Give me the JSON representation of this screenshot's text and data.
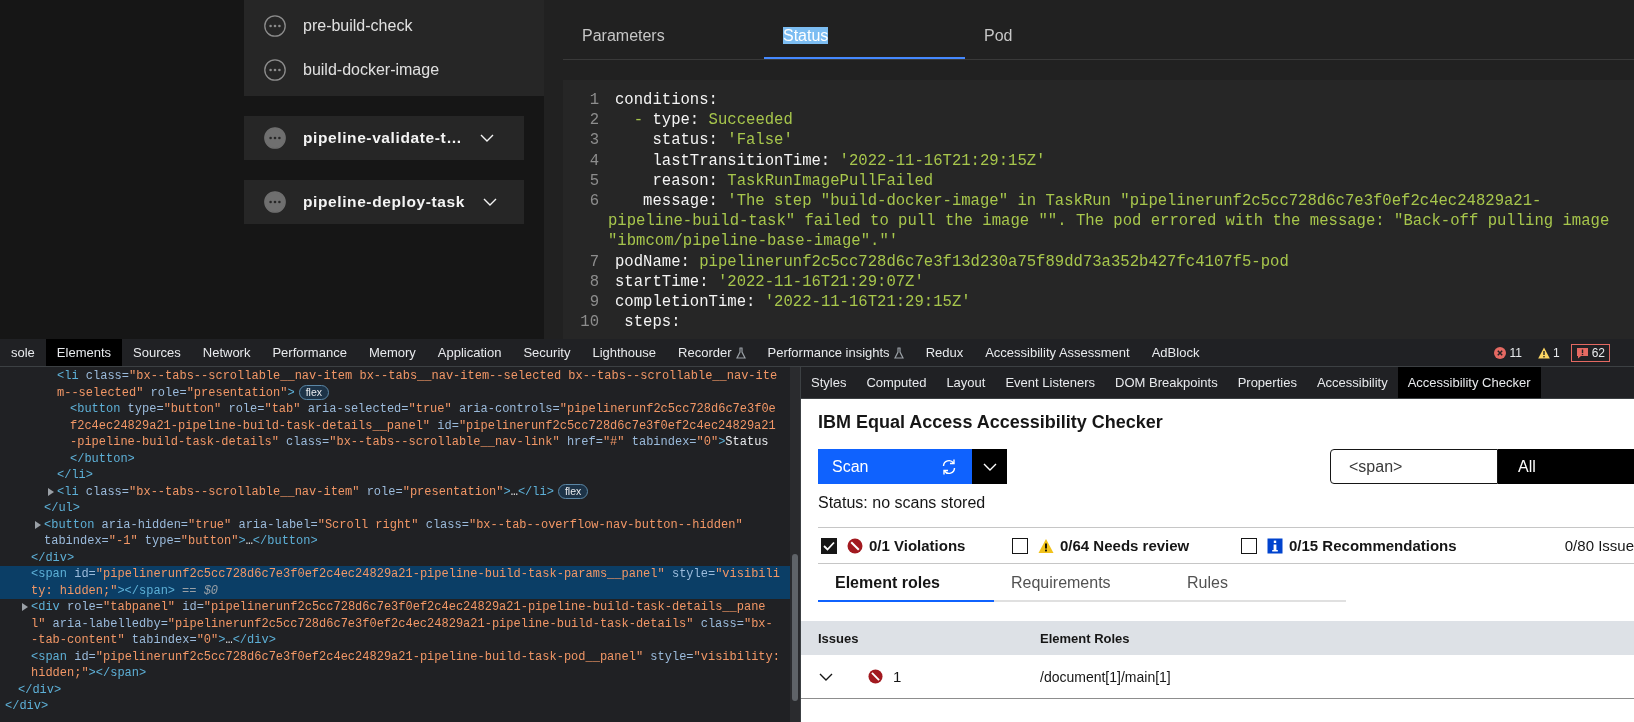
{
  "app": {
    "sidebar": {
      "steps": [
        {
          "label": "pre-build-check"
        },
        {
          "label": "build-docker-image"
        }
      ],
      "tasks": [
        {
          "label": "pipeline-validate-t…",
          "expanded": false
        },
        {
          "label": "pipeline-deploy-task",
          "expanded": false
        }
      ]
    },
    "tabs": [
      {
        "label": "Parameters",
        "selected": false,
        "highlighted": false
      },
      {
        "label": "Status",
        "selected": true,
        "highlighted": true
      },
      {
        "label": "Pod",
        "selected": false,
        "highlighted": false
      }
    ],
    "code_lines": [
      {
        "number": "1",
        "key": "conditions:"
      },
      {
        "number": "2",
        "bullet": "  -",
        "key": " type:",
        "value": "Succeeded"
      },
      {
        "number": "3",
        "key": "    status:",
        "value": "'False'"
      },
      {
        "number": "4",
        "key": "    lastTransitionTime:",
        "value": "'2022-11-16T21:29:15Z'"
      },
      {
        "number": "5",
        "key": "    reason:",
        "value": "TaskRunImagePullFailed"
      },
      {
        "number": "6",
        "key": "   message:",
        "value": "'The step \"build-docker-image\" in TaskRun \"pipelinerunf2c5cc728d6c7e3f0ef2c4ec24829a21-",
        "continued": [
          "pipeline-build-task\" failed to pull the image \"\". The pod errored with the message: \"Back-off pulling image",
          "\"ibmcom/pipeline-base-image\".\"'"
        ]
      },
      {
        "number": "7",
        "key": "podName:",
        "value": "pipelinerunf2c5cc728d6c7e3f13d230a75f89dd73a352b427fc4107f5-pod"
      },
      {
        "number": "8",
        "key": "startTime:",
        "value": "'2022-11-16T21:29:07Z'"
      },
      {
        "number": "9",
        "key": "completionTime:",
        "value": "'2022-11-16T21:29:15Z'"
      },
      {
        "number": "10",
        "key": " steps:"
      }
    ]
  },
  "devtools": {
    "tabs": [
      {
        "label": "sole",
        "selected": false,
        "experimental": false
      },
      {
        "label": "Elements",
        "selected": true,
        "experimental": false
      },
      {
        "label": "Sources",
        "selected": false,
        "experimental": false
      },
      {
        "label": "Network",
        "selected": false,
        "experimental": false
      },
      {
        "label": "Performance",
        "selected": false,
        "experimental": false
      },
      {
        "label": "Memory",
        "selected": false,
        "experimental": false
      },
      {
        "label": "Application",
        "selected": false,
        "experimental": false
      },
      {
        "label": "Security",
        "selected": false,
        "experimental": false
      },
      {
        "label": "Lighthouse",
        "selected": false,
        "experimental": false
      },
      {
        "label": "Recorder",
        "selected": false,
        "experimental": true
      },
      {
        "label": "Performance insights",
        "selected": false,
        "experimental": true
      },
      {
        "label": "Redux",
        "selected": false,
        "experimental": false
      },
      {
        "label": "Accessibility Assessment",
        "selected": false,
        "experimental": false
      },
      {
        "label": "AdBlock",
        "selected": false,
        "experimental": false
      }
    ],
    "counters": [
      {
        "kind": "error",
        "count": "11"
      },
      {
        "kind": "warning",
        "count": "1"
      },
      {
        "kind": "issues",
        "count": "62"
      }
    ],
    "dom": [
      {
        "close": "</div>",
        "selected": false,
        "children": [
          {
            "close": "</div>",
            "selected": false,
            "children": [
              {
                "close": "</div>",
                "selected": false,
                "children": [
                  {
                    "close": "</ul>",
                    "selected": false,
                    "children": [
                      {
                        "open": [
                          "<li class=\"bx--tabs--scrollable__nav-item bx--tabs__nav-item--selected bx--tabs--scrollable__nav-ite",
                          "m--selected\" role=\"presentation\">"
                        ],
                        "badge": "flex",
                        "close": "</li>",
                        "selected": false,
                        "children": [
                          {
                            "open": [
                              "<button type=\"button\" role=\"tab\" aria-selected=\"true\" aria-controls=\"pipelinerunf2c5cc728d6c7e3f0e",
                              "f2c4ec24829a21-pipeline-build-task-details__panel\" id=\"pipelinerunf2c5cc728d6c7e3f0ef2c4ec24829a21",
                              "-pipeline-build-task-details\" class=\"bx--tabs--scrollable__nav-link\" href=\"#\" tabindex=\"0\">Status"
                            ],
                            "close": "</button>",
                            "selected": false
                          }
                        ]
                      },
                      {
                        "open": [
                          "<li class=\"bx--tabs--scrollable__nav-item\" role=\"presentation\">…</li>"
                        ],
                        "badge": "flex",
                        "expanded": false,
                        "selected": false
                      }
                    ]
                  },
                  {
                    "open": [
                      "<button aria-hidden=\"true\" aria-label=\"Scroll right\" class=\"bx--tab--overflow-nav-button--hidden\"",
                      "tabindex=\"-1\" type=\"button\">…</button>"
                    ],
                    "expanded": false,
                    "selected": false
                  }
                ]
              },
              {
                "open": [
                  "<span id=\"pipelinerunf2c5cc728d6c7e3f0ef2c4ec24829a21-pipeline-build-task-params__panel\" style=\"visibili",
                  "ty: hidden;\"></span>"
                ],
                "ref": "== $0",
                "selected": true
              },
              {
                "open": [
                  "<div role=\"tabpanel\" id=\"pipelinerunf2c5cc728d6c7e3f0ef2c4ec24829a21-pipeline-build-task-details__pane",
                  "l\" aria-labelledby=\"pipelinerunf2c5cc728d6c7e3f0ef2c4ec24829a21-pipeline-build-task-details\" class=\"bx-",
                  "-tab-content\" tabindex=\"0\">…</div>"
                ],
                "expanded": false,
                "selected": false
              },
              {
                "open": [
                  "<span id=\"pipelinerunf2c5cc728d6c7e3f0ef2c4ec24829a21-pipeline-build-task-pod__panel\" style=\"visibility:",
                  "hidden;\"></span>"
                ],
                "selected": false
              }
            ]
          }
        ]
      }
    ],
    "side_tabs": [
      {
        "label": "Styles",
        "selected": false
      },
      {
        "label": "Computed",
        "selected": false
      },
      {
        "label": "Layout",
        "selected": false
      },
      {
        "label": "Event Listeners",
        "selected": false
      },
      {
        "label": "DOM Breakpoints",
        "selected": false
      },
      {
        "label": "Properties",
        "selected": false
      },
      {
        "label": "Accessibility",
        "selected": false
      },
      {
        "label": "Accessibility Checker",
        "selected": true
      }
    ],
    "checker": {
      "title": "IBM Equal Access Accessibility Checker",
      "scan_button": "Scan",
      "filter": {
        "value": "<span>"
      },
      "scope": "All",
      "status": "Status: no scans stored",
      "filters": [
        {
          "kind": "violation",
          "label": "0/1 Violations",
          "checked": true
        },
        {
          "kind": "warning",
          "label": "0/64 Needs review",
          "checked": false
        },
        {
          "kind": "info",
          "label": "0/15 Recommendations",
          "checked": false
        }
      ],
      "issue_total": "0/80 Issue",
      "tabs": [
        {
          "label": "Element roles",
          "selected": true
        },
        {
          "label": "Requirements",
          "selected": false
        },
        {
          "label": "Rules",
          "selected": false
        }
      ],
      "table": {
        "columns": [
          "Issues",
          "Element Roles"
        ],
        "rows": [
          {
            "expanded": false,
            "kind": "violation",
            "count": "1",
            "role_path": "/document[1]/main[1]"
          }
        ]
      }
    }
  }
}
